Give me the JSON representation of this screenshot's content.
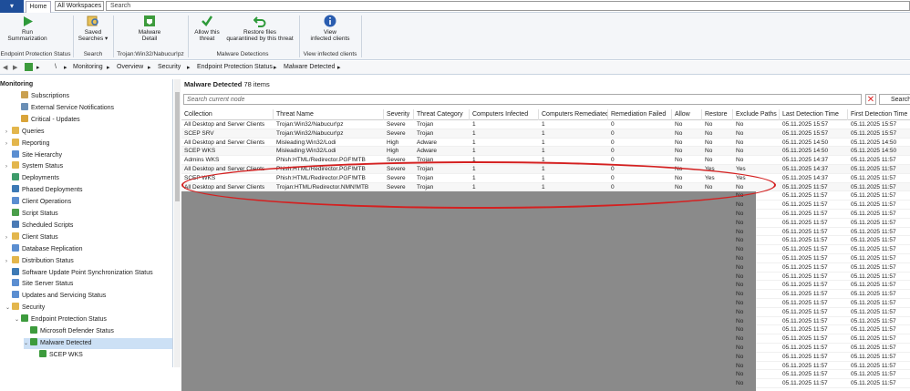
{
  "topbar": {
    "app_menu": "▾",
    "home_tab": "Home",
    "workspace": "All Workspaces",
    "search": "Search"
  },
  "ribbon": {
    "buttons": [
      {
        "label1": "Run",
        "label2": "Summarization"
      },
      {
        "label1": "Saved",
        "label2": "Searches ▾"
      },
      {
        "label1": "Malware",
        "label2": "Detail"
      },
      {
        "label1": "Allow this",
        "label2": "threat"
      },
      {
        "label1": "Restore files",
        "label2": "quarantined by this threat"
      },
      {
        "label1": "View",
        "label2": "infected clients"
      }
    ],
    "groups": [
      "Endpoint Protection Status",
      "Search",
      "Trojan:Win32/Nabucur!pz",
      "Malware Detections",
      "View infected clients"
    ]
  },
  "address": {
    "root": "\\",
    "crumbs": [
      "Monitoring",
      "Overview",
      "Security",
      "Endpoint Protection Status",
      "Malware Detected"
    ]
  },
  "nav": {
    "header": "Monitoring",
    "items": [
      {
        "label": "Subscriptions",
        "level": 2,
        "color": "#c9a050"
      },
      {
        "label": "External Service Notifications",
        "level": 2,
        "color": "#6b8fb5"
      },
      {
        "label": "Critical - Updates",
        "level": 2,
        "color": "#d9a43a"
      },
      {
        "label": "Queries",
        "level": 1,
        "color": "#e3b64c",
        "toggle": "›"
      },
      {
        "label": "Reporting",
        "level": 1,
        "color": "#e3b64c",
        "toggle": "›"
      },
      {
        "label": "Site Hierarchy",
        "level": 1,
        "color": "#5b8ed1"
      },
      {
        "label": "System Status",
        "level": 1,
        "color": "#e3b64c",
        "toggle": "›"
      },
      {
        "label": "Deployments",
        "level": 1,
        "color": "#3d9b6a"
      },
      {
        "label": "Phased Deployments",
        "level": 1,
        "color": "#3d7ab5"
      },
      {
        "label": "Client Operations",
        "level": 1,
        "color": "#5b8ed1"
      },
      {
        "label": "Script Status",
        "level": 1,
        "color": "#4a9e4a"
      },
      {
        "label": "Scheduled Scripts",
        "level": 1,
        "color": "#4a7ab5"
      },
      {
        "label": "Client Status",
        "level": 1,
        "color": "#e3b64c",
        "toggle": "›"
      },
      {
        "label": "Database Replication",
        "level": 1,
        "color": "#5b8ed1"
      },
      {
        "label": "Distribution Status",
        "level": 1,
        "color": "#e3b64c",
        "toggle": "›"
      },
      {
        "label": "Software Update Point Synchronization Status",
        "level": 1,
        "color": "#3d7ab5"
      },
      {
        "label": "Site Server Status",
        "level": 1,
        "color": "#5b8ed1"
      },
      {
        "label": "Updates and Servicing Status",
        "level": 1,
        "color": "#5b8ed1"
      },
      {
        "label": "Security",
        "level": 1,
        "color": "#e3b64c",
        "toggle": "⌄"
      },
      {
        "label": "Endpoint Protection Status",
        "level": 2,
        "color": "#3d9b3d",
        "toggle": "⌄"
      },
      {
        "label": "Microsoft Defender Status",
        "level": 3,
        "color": "#3d9b3d"
      },
      {
        "label": "Malware Detected",
        "level": 3,
        "color": "#3d9b3d",
        "toggle": "⌄",
        "selected": true
      },
      {
        "label": "SCEP WKS",
        "level": 4,
        "color": "#3d9b3d"
      }
    ]
  },
  "main": {
    "title": "Malware Detected",
    "count": "78 items",
    "search_placeholder": "Search current node",
    "search_button": "Search",
    "columns": [
      "Collection",
      "Threat Name",
      "Severity",
      "Threat Category",
      "Computers Infected",
      "Computers Remediated",
      "Remediation Failed",
      "Allow",
      "Restore",
      "Exclude Paths",
      "Last Detection Time",
      "First Detection Time"
    ],
    "rows": [
      [
        "All Desktop and Server Clients",
        "Trojan:Win32/Nabucur!pz",
        "Severe",
        "Trojan",
        "1",
        "1",
        "0",
        "No",
        "No",
        "No",
        "05.11.2025 15:57",
        "05.11.2025 15:57"
      ],
      [
        "SCEP SRV",
        "Trojan:Win32/Nabucur!pz",
        "Severe",
        "Trojan",
        "1",
        "1",
        "0",
        "No",
        "No",
        "No",
        "05.11.2025 15:57",
        "05.11.2025 15:57"
      ],
      [
        "All Desktop and Server Clients",
        "Misleading:Win32/Lodi",
        "High",
        "Adware",
        "1",
        "1",
        "0",
        "No",
        "No",
        "No",
        "05.11.2025 14:50",
        "05.11.2025 14:50"
      ],
      [
        "SCEP WKS",
        "Misleading:Win32/Lodi",
        "High",
        "Adware",
        "1",
        "1",
        "0",
        "No",
        "No",
        "No",
        "05.11.2025 14:50",
        "05.11.2025 14:50"
      ],
      [
        "Admins WKS",
        "Phish:HTML/Redirector.PGF!MTB",
        "Severe",
        "Trojan",
        "1",
        "1",
        "0",
        "No",
        "No",
        "No",
        "05.11.2025 14:37",
        "05.11.2025 11:57"
      ],
      [
        "All Desktop and Server Clients",
        "Phish:HTML/Redirector.PGF!MTB",
        "Severe",
        "Trojan",
        "1",
        "1",
        "0",
        "No",
        "Yes",
        "Yes",
        "05.11.2025 14:37",
        "05.11.2025 11:57"
      ],
      [
        "SCEP WKS",
        "Phish:HTML/Redirector.PGF!MTB",
        "Severe",
        "Trojan",
        "1",
        "1",
        "0",
        "No",
        "Yes",
        "Yes",
        "05.11.2025 14:37",
        "05.11.2025 11:57"
      ],
      [
        "All Desktop and Server Clients",
        "Trojan:HTML/Redirector.NMN!MTB",
        "Severe",
        "Trojan",
        "1",
        "1",
        "0",
        "No",
        "No",
        "No",
        "05.11.2025 11:57",
        "05.11.2025 11:57"
      ]
    ],
    "redacted_rows": [
      [
        "No",
        "No",
        "05.11.2025 11:57",
        "05.11.2025 11:57"
      ],
      [
        "No",
        "No",
        "05.11.2025 11:57",
        "05.11.2025 11:57"
      ],
      [
        "No",
        "No",
        "05.11.2025 11:57",
        "05.11.2025 11:57"
      ],
      [
        "No",
        "No",
        "05.11.2025 11:57",
        "05.11.2025 11:57"
      ],
      [
        "No",
        "No",
        "05.11.2025 11:57",
        "05.11.2025 11:57"
      ],
      [
        "No",
        "No",
        "05.11.2025 11:57",
        "05.11.2025 11:57"
      ],
      [
        "No",
        "No",
        "05.11.2025 11:57",
        "05.11.2025 11:57"
      ],
      [
        "No",
        "No",
        "05.11.2025 11:57",
        "05.11.2025 11:57"
      ],
      [
        "No",
        "No",
        "05.11.2025 11:57",
        "05.11.2025 11:57"
      ],
      [
        "No",
        "No",
        "05.11.2025 11:57",
        "05.11.2025 11:57"
      ],
      [
        "No",
        "No",
        "05.11.2025 11:57",
        "05.11.2025 11:57"
      ],
      [
        "No",
        "No",
        "05.11.2025 11:57",
        "05.11.2025 11:57"
      ],
      [
        "No",
        "No",
        "05.11.2025 11:57",
        "05.11.2025 11:57"
      ],
      [
        "No",
        "No",
        "05.11.2025 11:57",
        "05.11.2025 11:57"
      ],
      [
        "No",
        "No",
        "05.11.2025 11:57",
        "05.11.2025 11:57"
      ],
      [
        "No",
        "No",
        "05.11.2025 11:57",
        "05.11.2025 11:57"
      ],
      [
        "No",
        "No",
        "05.11.2025 11:57",
        "05.11.2025 11:57"
      ],
      [
        "No",
        "No",
        "05.11.2025 11:57",
        "05.11.2025 11:57"
      ],
      [
        "No",
        "No",
        "05.11.2025 11:57",
        "05.11.2025 11:57"
      ],
      [
        "No",
        "No",
        "05.11.2025 11:57",
        "05.11.2025 11:57"
      ],
      [
        "No",
        "No",
        "05.11.2025 11:57",
        "05.11.2025 11:57"
      ],
      [
        "No",
        "No",
        "05.11.2025 11:57",
        "05.11.2025 11:57"
      ]
    ],
    "highlight_color": "#d42020"
  }
}
